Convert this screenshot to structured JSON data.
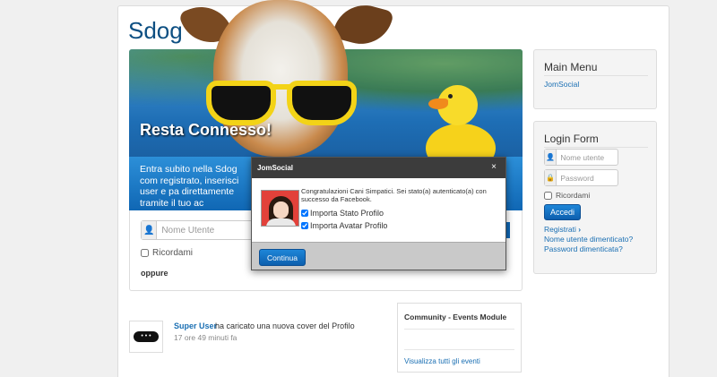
{
  "site": {
    "title": "Sdog"
  },
  "hero": {
    "title": "Resta Connesso!",
    "text": "Entra subito nella Sdog com registrato, inserisci user e pa direttamente tramite il tuo ac"
  },
  "login_main": {
    "username_placeholder": "Nome Utente",
    "remember_label": "Ricordami",
    "or_label": "oppure"
  },
  "activity": {
    "user": "Super User",
    "text": "ha caricato una nuova cover del Profilo",
    "time": "17 ore 49 minuti fa"
  },
  "events_module": {
    "title": "Community - Events Module",
    "link": "Visualizza tutti gli eventi"
  },
  "main_menu": {
    "title": "Main Menu",
    "items": [
      "JomSocial"
    ]
  },
  "login_form": {
    "title": "Login Form",
    "username_placeholder": "Nome utente",
    "password_placeholder": "Password",
    "remember_label": "Ricordami",
    "login_button": "Accedi",
    "register_link": "Registrati",
    "forgot_username": "Nome utente dimenticato?",
    "forgot_password": "Password dimenticata?"
  },
  "modal": {
    "title": "JomSocial",
    "close": "×",
    "message": "Congratulazioni Cani Simpatici. Sei stato(a) autenticato(a) con successo da Facebook.",
    "options": [
      "Importa Stato Profilo",
      "Importa Avatar Profilo"
    ],
    "continue_button": "Continua"
  }
}
